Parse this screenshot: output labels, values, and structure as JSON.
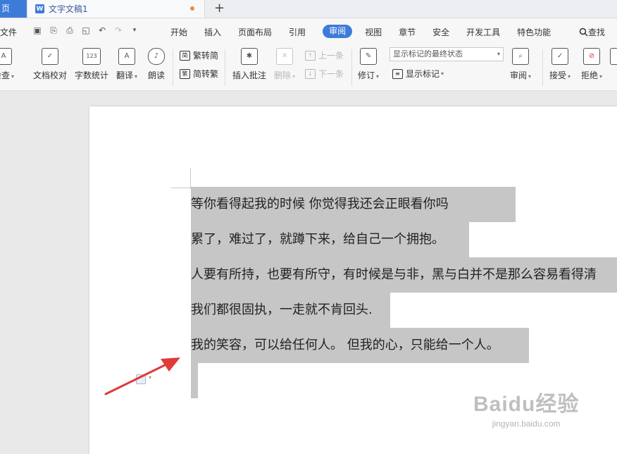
{
  "tabs": {
    "home_label": "页",
    "doc_title": "文字文稿1",
    "doc_icon": "W",
    "new_tab": "+"
  },
  "menu": {
    "file": "文件",
    "items": [
      "开始",
      "插入",
      "页面布局",
      "引用",
      "审阅",
      "视图",
      "章节",
      "安全",
      "开发工具",
      "特色功能"
    ],
    "active_index": 4,
    "search": "查找"
  },
  "ribbon": {
    "spell_check": "检查",
    "proofread": "文档校对",
    "word_count": "字数统计",
    "translate": "翻译",
    "read_aloud": "朗读",
    "trad_to_simp": "繁转简",
    "simp_to_trad": "简转繁",
    "insert_comment": "插入批注",
    "delete": "删除",
    "prev": "上一条",
    "next": "下一条",
    "track_changes": "修订",
    "markup_select": "显示标记的最终状态",
    "show_markup": "显示标记",
    "review": "审阅",
    "accept": "接受",
    "reject": "拒绝"
  },
  "document": {
    "lines": [
      "等你看得起我的时候 你觉得我还会正眼看你吗",
      "累了，难过了，就蹲下来，给自己一个拥抱。",
      "人要有所持，也要有所守，有时候是与非，黑与白并不是那么容易看得清",
      "我们都很固执，一走就不肯回头.",
      "我的笑容，可以给任何人。 但我的心，只能给一个人。"
    ]
  },
  "watermark": {
    "logo": "Baidu经验",
    "url": "jingyan.baidu.com"
  },
  "colors": {
    "accent": "#3d7bd9",
    "selection": "#c6c6c6",
    "arrow": "#e03a3a"
  }
}
